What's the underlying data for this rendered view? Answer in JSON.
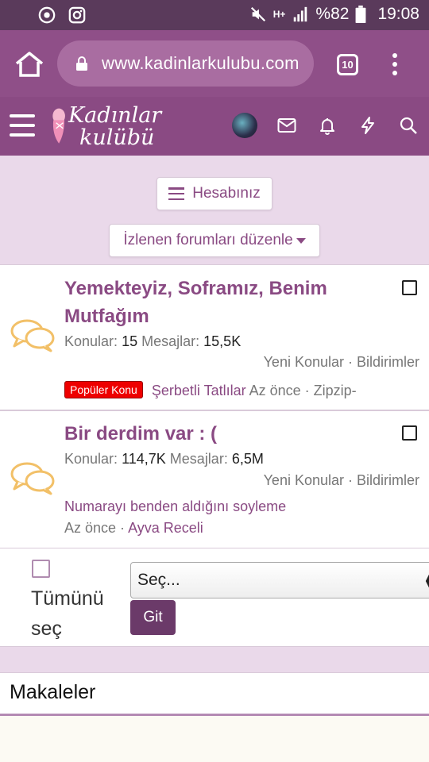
{
  "status_bar": {
    "battery": "%82",
    "time": "19:08",
    "network": "H+",
    "left_icons": [
      "chrome-icon",
      "instagram-icon"
    ],
    "right_icons": [
      "mute-icon",
      "signal-icon",
      "battery-icon"
    ]
  },
  "browser": {
    "url": "www.kadinlarkulubu.com",
    "tab_count": "10"
  },
  "site": {
    "logo_line1": "Kadınlar",
    "logo_line2": "kulübü",
    "header_icons": [
      "menu-icon",
      "avatar",
      "mail-icon",
      "bell-icon",
      "lightning-icon",
      "search-icon"
    ]
  },
  "actions": {
    "account_label": "Hesabınız",
    "watched_label": "İzlenen forumları düzenle"
  },
  "forums": [
    {
      "title": "Yemekteyiz, Soframız, Benim Mutfağım",
      "threads_label": "Konular:",
      "threads": "15",
      "messages_label": "Mesajlar:",
      "messages": "15,5K",
      "links": "Yeni Konular · Bildirimler",
      "badge": "Popüler Konu",
      "latest_title": "Şerbetli Tatlılar",
      "latest_meta": "Az önce · Zipzip-"
    },
    {
      "title": "Bir derdim var : (",
      "threads_label": "Konular:",
      "threads": "114,7K",
      "messages_label": "Mesajlar:",
      "messages": "6,5M",
      "links": "Yeni Konular · Bildirimler",
      "latest_title": "Numarayı benden aldığını soyleme",
      "latest_time": "Az önce",
      "latest_sep": " · ",
      "latest_user": "Ayva Receli"
    }
  ],
  "bulk": {
    "select_all": "Tümünü seç",
    "dropdown_value": "Seç...",
    "go_button": "Git"
  },
  "section": {
    "articles": "Makaleler"
  },
  "colors": {
    "status_bar": "#5a3a5b",
    "browser_bar": "#8f4f88",
    "site_header": "#8a4a83",
    "accent": "#8a4a83",
    "badge": "#e00000"
  }
}
